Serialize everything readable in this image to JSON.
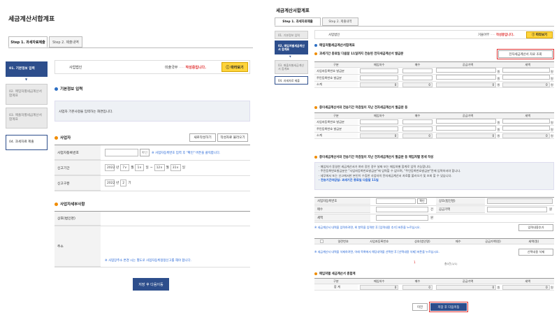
{
  "left": {
    "title": "세금계산서합계표",
    "tabs": [
      "Step 1. 과세자료제출",
      "Step 2. 제출내역"
    ],
    "steps": [
      "01. 기본정보 입력",
      "02. 매입처별세금계산서 합계표",
      "03. 매출처별세금계산서 합계표",
      "04. 과세자료 제출"
    ],
    "biz_type": "사업법인",
    "progress_label": "미출국부",
    "progress_dots": "·····",
    "progress_status": "작성중입니다.",
    "help_button": "따라보기",
    "basic_section": "기본정보 입력",
    "basic_note": "사업자 기본사항을 입력하는 화면입니다.",
    "business_section": "사업자",
    "new_write_button": "새로작성하기",
    "load_button": "작성자료 불러오기",
    "rows": {
      "brn_label": "사업자등록번호",
      "confirm_button": "확인",
      "brn_hint": "※ 사업자등록번호 입력 후 \"확인\" 버튼을 클릭합니다.",
      "period_label": "신고기간",
      "period_year": "2022",
      "period_y": "년",
      "period_m1": "7",
      "period_mm": "월",
      "period_d1": "1",
      "period_dd": "일",
      "period_sep": "~",
      "period_m2": "12",
      "period_d2": "31",
      "type_label": "신고구분",
      "type_year": "2022",
      "type_y": "년",
      "type_half": "2",
      "type_period": "기"
    },
    "taxpayer_section": "사업자세부사항",
    "company_label": "상호(법인명)",
    "address_label": "주소",
    "address_hint": "※ 사업장주소 변경 시는 별도로 사업자등록정정신고를 해야 합니다.",
    "save_next": "저장 후 다음이동"
  },
  "right": {
    "title": "세금계산서합계표",
    "tabs": [
      "Step 1. 과세자료제출",
      "Step 2. 제출내역"
    ],
    "steps": [
      "01. 기본정보 입력",
      "02. 매입처별세금계산서 합계표",
      "03. 매출처별세금계산서 합계표",
      "04. 과세자료 제출"
    ],
    "biz_type": "사업법인",
    "progress_label": "거울어부",
    "progress_dots": "·····",
    "progress_status": "작성중입니다.",
    "help_button": "따라보기",
    "main_section": "매입처별세금계산서합계표",
    "sec1": "과세기간 종료일 다음달 11일까지 전송된 전자세금계산서 발급분",
    "query_button": "전자세금계산서 자료 조회",
    "cols1": [
      "구분",
      "매입처수",
      "매수",
      "공급가액",
      "세액"
    ],
    "rows1": [
      "사업자등록번호 발급분",
      "주민등록번호 발급분",
      "소계"
    ],
    "sum1": [
      "0",
      "0",
      "0",
      "0"
    ],
    "unit": "원",
    "sec2": "종이세금계산서와 전송기간 마감일이 지난 전자세금계산서 발급분 등",
    "rows2": [
      "사업자등록번호 발급분",
      "주민등록번호 발급분",
      "소계"
    ],
    "sum2": [
      "0",
      "0",
      "0",
      "0"
    ],
    "sec3": "종이세금계산서와 전송기간 마감일이 지난 전자세금계산서 발급분 등 매입처별 명세 작성",
    "notes": [
      "· 매입처가 동일한 세금계산서가 여러 장인 경우 날짜 또는 매입처별 합계로 입력 가능합니다.",
      "· 주민등록번호발급분은 \"사업자등록번호발급분\"에 입력할 수 없으며, \"주민등록번호발급분\"란에 입력하셔야 합니다.",
      "· 세무에서 또는 신고에서만 본인이 수집한 사업자의 전자세금계산서 자료를 불러오기 및 조회 할 수 있습니다.",
      "· 전송기간마감일: 과세기간 종료일 다음달 11일"
    ],
    "form": {
      "brn": "사업자등록번호",
      "confirm": "확인",
      "company": "상호(법인명)",
      "count": "매수",
      "count_unit": "건",
      "supply": "공급가액",
      "tax": "세액",
      "won": "원"
    },
    "form_hint": "※ 세금계산서 내역을 입력하려면, 위 항목을 입력한 후 [입력내용 추가] 버튼을 누르십시오.",
    "add_button": "입력내용추가",
    "cols3": [
      "",
      "일련번호",
      "사업자등록번호",
      "상호(법인명)",
      "매수",
      "공급가액(원)",
      "세액(원)"
    ],
    "list_hint": "※ 세금계산서 내역을 삭제하려면, 아래 목록에서 해당내역을 선택한 후 [선택내용 삭제] 버튼을 누르십시오.",
    "delete_button": "선택내용 삭제",
    "page": "1",
    "page_total": "총0건(1/1)",
    "sec4": "매입처별 세금계산서 총합계",
    "cols4": [
      "구분",
      "매입처수",
      "매수",
      "공급가액",
      "세액"
    ],
    "total_label": "합 계",
    "totals": [
      "0",
      "0",
      "0",
      "0"
    ],
    "prev_button": "이전",
    "save_next": "저장 후 다음이동"
  },
  "colors": {
    "accent": "#2d4e8c",
    "highlight": "#e03131",
    "help": "#ffd43b"
  }
}
